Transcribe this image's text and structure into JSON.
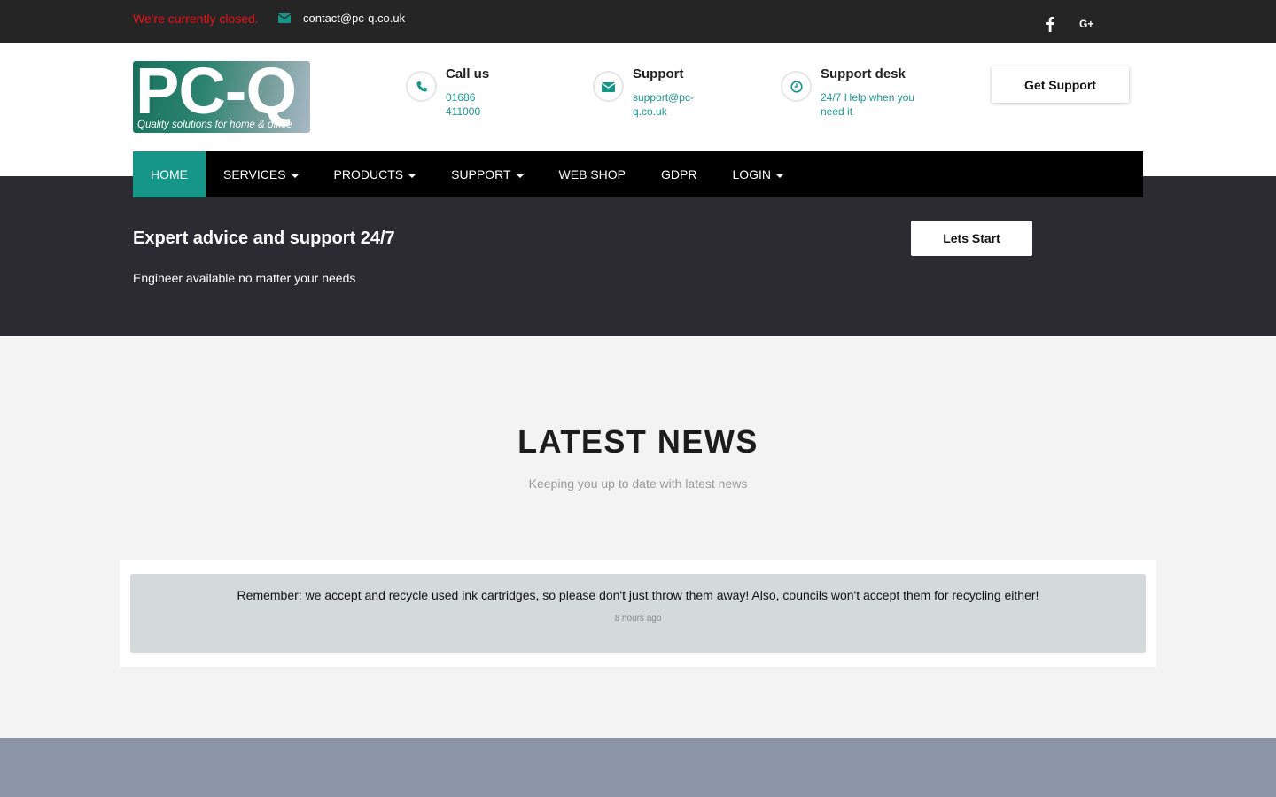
{
  "topbar": {
    "status": "We're currently closed.",
    "email": "contact@pc-q.co.uk",
    "social": [
      "facebook-icon",
      "google-plus-icon"
    ],
    "gplus_label": "G+"
  },
  "logo": {
    "main": "PC-Q",
    "tagline": "Quality solutions for home & office"
  },
  "contacts": [
    {
      "icon": "phone-icon",
      "title": "Call us",
      "sub": "01686 411000"
    },
    {
      "icon": "envelope-icon",
      "title": "Support",
      "sub": "support@pc-q.co.uk"
    },
    {
      "icon": "clock-icon",
      "title": "Support desk",
      "sub": "24/7 Help when you need it"
    }
  ],
  "header": {
    "cta": "Get Support"
  },
  "nav": {
    "items": [
      {
        "label": "HOME",
        "active": true,
        "dropdown": false
      },
      {
        "label": "SERVICES",
        "dropdown": true
      },
      {
        "label": "PRODUCTS",
        "dropdown": true
      },
      {
        "label": "SUPPORT",
        "dropdown": true
      },
      {
        "label": "WEB SHOP",
        "dropdown": false
      },
      {
        "label": "GDPR",
        "dropdown": false
      },
      {
        "label": "LOGIN",
        "dropdown": true
      }
    ]
  },
  "hero": {
    "title": "Expert advice and support 24/7",
    "subtitle": "Engineer available no matter your needs",
    "cta": "Lets Start"
  },
  "news": {
    "title": "LATEST NEWS",
    "subtitle": "Keeping you up to date with latest news",
    "items": [
      {
        "message": "Remember: we accept and recycle used ink cartridges, so please don't just throw them away! Also, councils won't accept them for recycling either!",
        "time": "8 hours ago"
      }
    ]
  },
  "colors": {
    "accent": "#159689",
    "closed": "#e8141a",
    "topbar": "#252525",
    "hero": "#2b2b31",
    "footer": "#8c95a5"
  }
}
